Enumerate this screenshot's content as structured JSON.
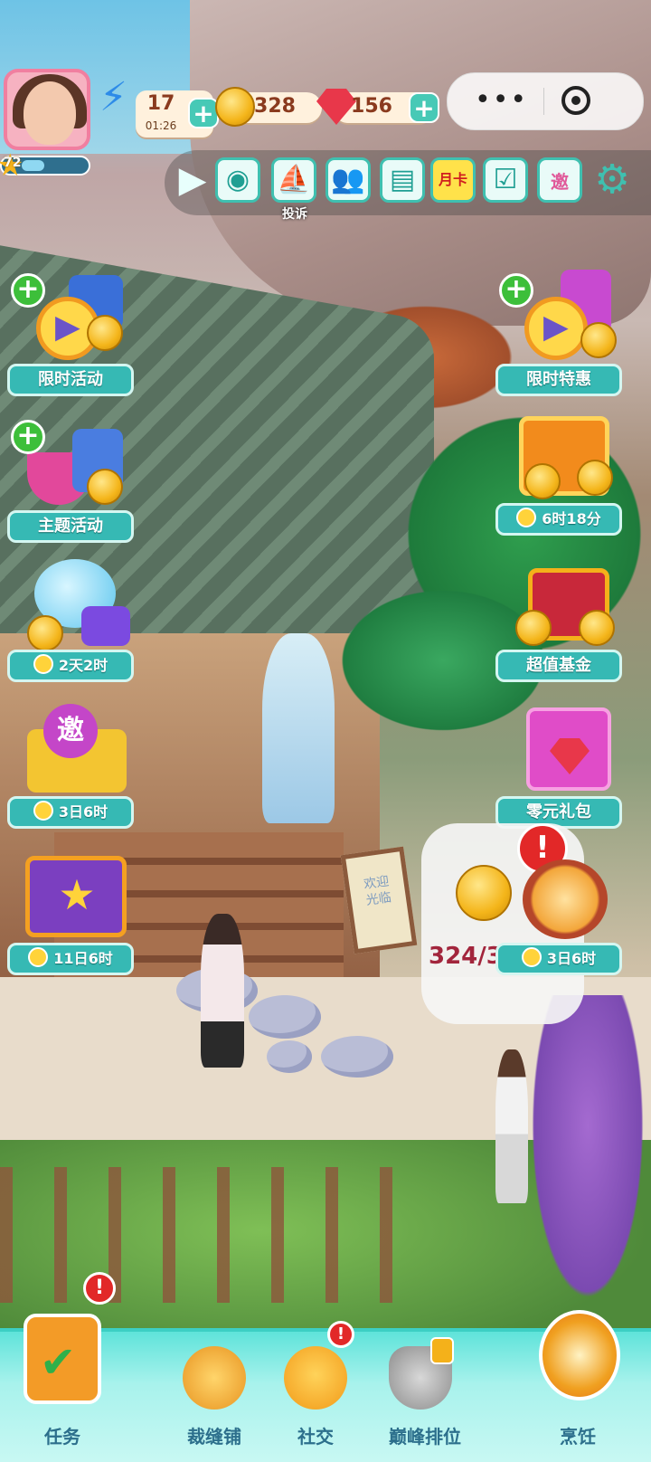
{
  "player": {
    "level": "72",
    "level_progress": 0.35
  },
  "resources": {
    "energy": {
      "value": "17",
      "timer": "01:26"
    },
    "coins": {
      "value": "328"
    },
    "gems": {
      "value": "156"
    }
  },
  "capsule": {
    "more": "•••"
  },
  "toolbar": {
    "report_label": "投诉",
    "card_label": "月卡",
    "invite_glyph": "邀"
  },
  "events_left": [
    {
      "label": "限时活动"
    },
    {
      "label": "主题活动"
    },
    {
      "timer": "2天2时"
    },
    {
      "timer": "3日6时",
      "glyph": "邀"
    },
    {
      "timer": "11日6时"
    }
  ],
  "events_right": [
    {
      "label": "限时特惠"
    },
    {
      "timer": "6时18分"
    },
    {
      "label": "超值基金"
    },
    {
      "label": "零元礼包"
    },
    {
      "timer": "3日6时"
    }
  ],
  "bubble": {
    "value": "324/3"
  },
  "signboard": {
    "text": "欢迎光临"
  },
  "nav": {
    "task": "任务",
    "tailor": "裁缝铺",
    "social": "社交",
    "peak": "巅峰排位",
    "cook": "烹饪"
  },
  "colors": {
    "teal": "#36b9b4",
    "alert": "#e22828",
    "coin": "#f4b51a",
    "gem": "#e8374a"
  },
  "icons": [
    "play-icon",
    "camera-icon",
    "report-icon",
    "friends-icon",
    "book-icon",
    "calendar-icon",
    "invite-icon",
    "gear-icon",
    "clock-icon",
    "plus-icon",
    "alert-icon",
    "lock-icon"
  ]
}
